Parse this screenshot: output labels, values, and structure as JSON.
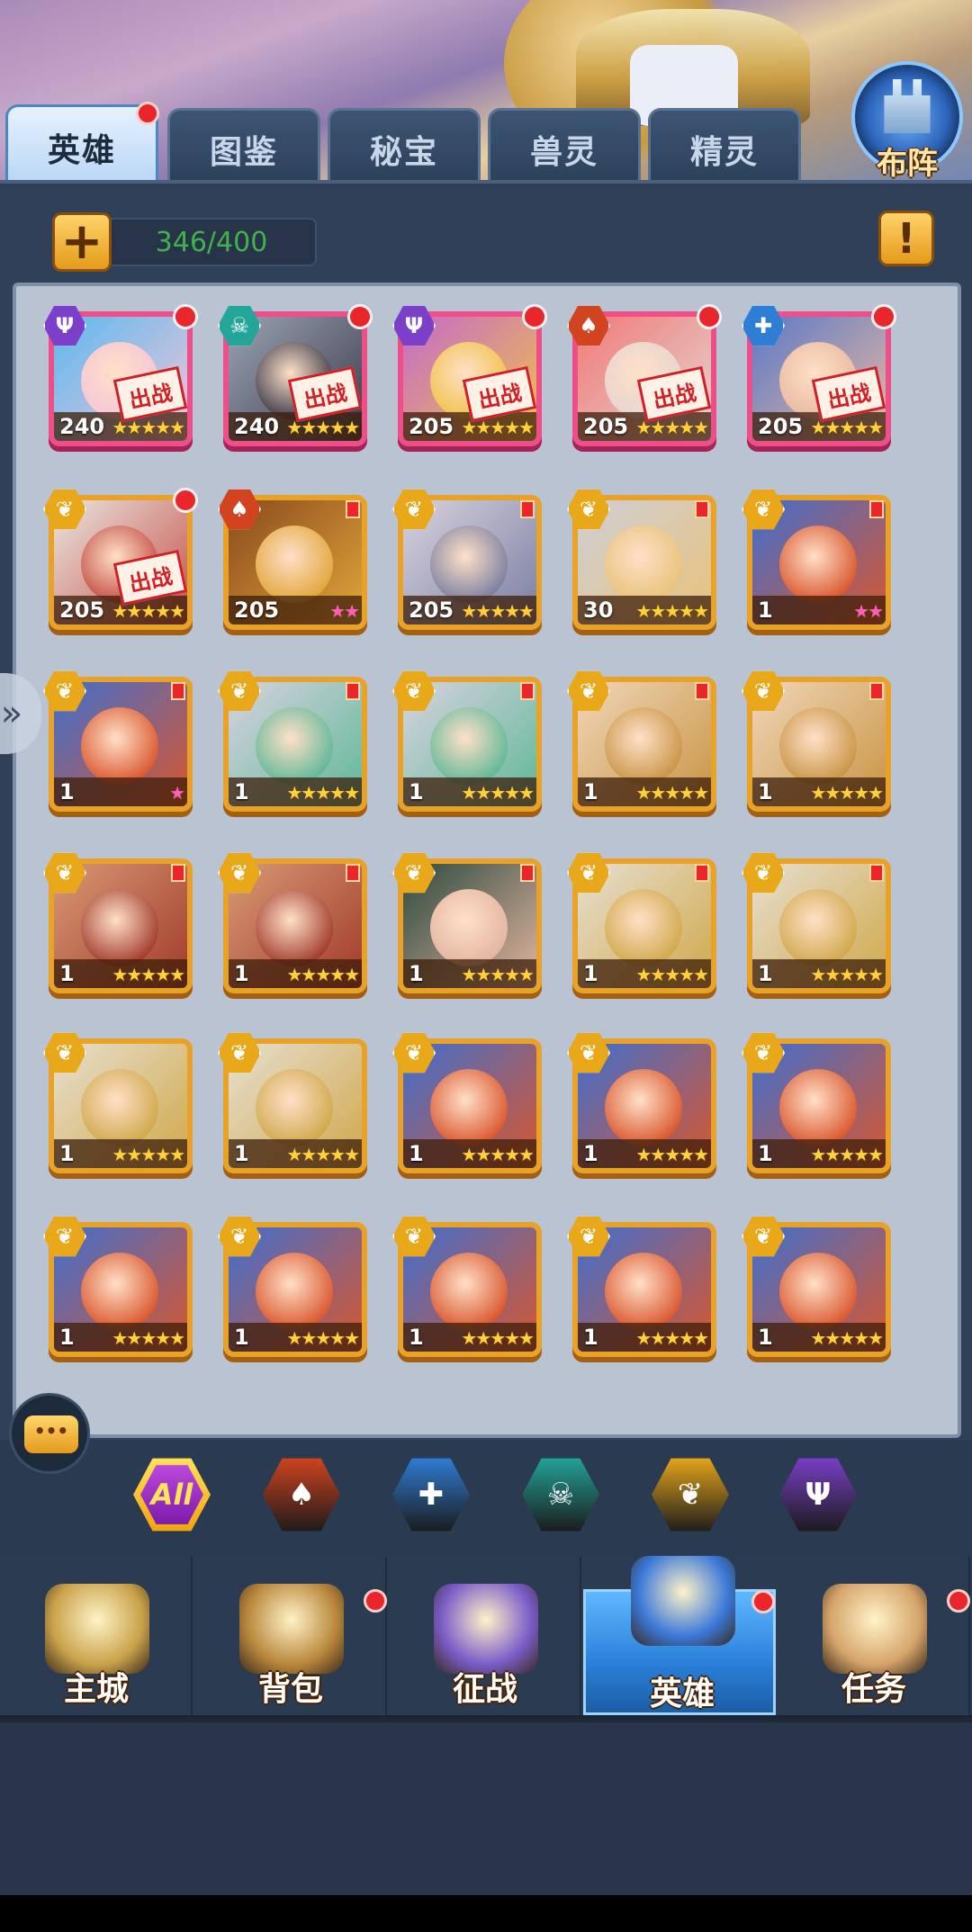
{
  "tabs": [
    {
      "label": "英雄",
      "active": true,
      "dot": true
    },
    {
      "label": "图鉴",
      "active": false,
      "dot": false
    },
    {
      "label": "秘宝",
      "active": false,
      "dot": false
    },
    {
      "label": "兽灵",
      "active": false,
      "dot": false
    },
    {
      "label": "精灵",
      "active": false,
      "dot": false
    }
  ],
  "formation_label": "布阵",
  "capacity": "346/400",
  "add_icon": "plus-icon",
  "info_icon": "exclamation-icon",
  "badge_text": "出战",
  "colors": {
    "gold_frame": "#e8a227",
    "pink_frame": "#ef4f88",
    "level_green": "#3fb34a",
    "red_dot": "#e8262b"
  },
  "factions": {
    "trident": {
      "icon": "trident-icon",
      "color": "#7b3fc9",
      "glyph": "Ψ"
    },
    "skull": {
      "icon": "skull-icon",
      "color": "#23a59a",
      "glyph": "☠"
    },
    "flame": {
      "icon": "flame-icon",
      "color": "#d2441f",
      "glyph": "♠"
    },
    "cross": {
      "icon": "cross-icon",
      "color": "#2f7ed6",
      "glyph": "✚"
    },
    "wing": {
      "icon": "wing-icon",
      "color": "#e8a81a",
      "glyph": "❦"
    }
  },
  "heroes": [
    {
      "level": "240",
      "faction": "trident",
      "stars": 5,
      "deployed": true,
      "dot": true,
      "frame": "pink",
      "palette": [
        "#5ab8f0",
        "#f4c6d8"
      ]
    },
    {
      "level": "240",
      "faction": "skull",
      "stars": 5,
      "deployed": true,
      "dot": true,
      "frame": "pink",
      "palette": [
        "#9aa3b4",
        "#3b3a48"
      ]
    },
    {
      "level": "205",
      "faction": "trident",
      "stars": 5,
      "deployed": true,
      "dot": true,
      "frame": "pink",
      "palette": [
        "#c56ac9",
        "#f0c24a"
      ]
    },
    {
      "level": "205",
      "faction": "flame",
      "stars": 5,
      "deployed": true,
      "dot": true,
      "frame": "pink",
      "palette": [
        "#f07a78",
        "#e5d5d0"
      ]
    },
    {
      "level": "205",
      "faction": "cross",
      "stars": 5,
      "deployed": true,
      "dot": true,
      "frame": "pink",
      "palette": [
        "#5c79c8",
        "#e8b9a0"
      ]
    },
    {
      "level": "205",
      "faction": "wing",
      "stars": 5,
      "deployed": true,
      "dot": true,
      "frame": "gold",
      "palette": [
        "#e9e6e0",
        "#c44f45"
      ]
    },
    {
      "level": "205",
      "faction": "flame",
      "stars": 2,
      "deployed": false,
      "dot": false,
      "flag": true,
      "frame": "gold",
      "pinkstars": true,
      "palette": [
        "#8a4a1d",
        "#e2a63a"
      ]
    },
    {
      "level": "205",
      "faction": "wing",
      "stars": 5,
      "deployed": false,
      "dot": false,
      "flag": true,
      "frame": "gold",
      "palette": [
        "#d8d2df",
        "#7a7fa0"
      ]
    },
    {
      "level": "30",
      "faction": "wing",
      "stars": 5,
      "deployed": false,
      "dot": false,
      "flag": true,
      "frame": "gold",
      "palette": [
        "#cfcfd6",
        "#e8c27a"
      ]
    },
    {
      "level": "1",
      "faction": "wing",
      "stars": 2,
      "deployed": false,
      "dot": false,
      "flag": true,
      "frame": "gold",
      "pinkstars": true,
      "palette": [
        "#3f6fd0",
        "#d9562d"
      ]
    },
    {
      "level": "1",
      "faction": "wing",
      "stars": 1,
      "deployed": false,
      "dot": false,
      "flag": true,
      "frame": "gold",
      "pinkstars": true,
      "palette": [
        "#3f6fd0",
        "#d9562d"
      ]
    },
    {
      "level": "1",
      "faction": "wing",
      "stars": 5,
      "deployed": false,
      "dot": false,
      "flag": true,
      "frame": "gold",
      "palette": [
        "#d8d2df",
        "#5fb898"
      ]
    },
    {
      "level": "1",
      "faction": "wing",
      "stars": 5,
      "deployed": false,
      "dot": false,
      "flag": true,
      "frame": "gold",
      "palette": [
        "#d8d2df",
        "#5fb898"
      ]
    },
    {
      "level": "1",
      "faction": "wing",
      "stars": 5,
      "deployed": false,
      "dot": false,
      "flag": true,
      "frame": "gold",
      "palette": [
        "#f0d6b8",
        "#c99444"
      ]
    },
    {
      "level": "1",
      "faction": "wing",
      "stars": 5,
      "deployed": false,
      "dot": false,
      "flag": true,
      "frame": "gold",
      "palette": [
        "#f0d6b8",
        "#c99444"
      ]
    },
    {
      "level": "1",
      "faction": "wing",
      "stars": 5,
      "deployed": false,
      "dot": false,
      "flag": true,
      "frame": "gold",
      "palette": [
        "#d79a74",
        "#a13a2a"
      ]
    },
    {
      "level": "1",
      "faction": "wing",
      "stars": 5,
      "deployed": false,
      "dot": false,
      "flag": true,
      "frame": "gold",
      "palette": [
        "#d79a74",
        "#a13a2a"
      ]
    },
    {
      "level": "1",
      "faction": "wing",
      "stars": 5,
      "deployed": false,
      "dot": false,
      "flag": true,
      "frame": "gold",
      "palette": [
        "#2b4a3f",
        "#e3b5a0"
      ]
    },
    {
      "level": "1",
      "faction": "wing",
      "stars": 5,
      "deployed": false,
      "dot": false,
      "flag": true,
      "frame": "gold",
      "palette": [
        "#e6dfd0",
        "#d0a84a"
      ]
    },
    {
      "level": "1",
      "faction": "wing",
      "stars": 5,
      "deployed": false,
      "dot": false,
      "flag": true,
      "frame": "gold",
      "palette": [
        "#e6dfd0",
        "#d0a84a"
      ]
    },
    {
      "level": "1",
      "faction": "wing",
      "stars": 5,
      "deployed": false,
      "dot": false,
      "flag": false,
      "frame": "gold",
      "palette": [
        "#e6dfd0",
        "#d0a84a"
      ]
    },
    {
      "level": "1",
      "faction": "wing",
      "stars": 5,
      "deployed": false,
      "dot": false,
      "flag": false,
      "frame": "gold",
      "palette": [
        "#e6dfd0",
        "#d0a84a"
      ]
    },
    {
      "level": "1",
      "faction": "wing",
      "stars": 5,
      "deployed": false,
      "dot": false,
      "flag": false,
      "frame": "gold",
      "palette": [
        "#3f6fd0",
        "#d9562d"
      ]
    },
    {
      "level": "1",
      "faction": "wing",
      "stars": 5,
      "deployed": false,
      "dot": false,
      "flag": false,
      "frame": "gold",
      "palette": [
        "#3f6fd0",
        "#d9562d"
      ]
    },
    {
      "level": "1",
      "faction": "wing",
      "stars": 5,
      "deployed": false,
      "dot": false,
      "flag": false,
      "frame": "gold",
      "palette": [
        "#3f6fd0",
        "#d9562d"
      ]
    },
    {
      "level": "1",
      "faction": "wing",
      "stars": 5,
      "deployed": false,
      "dot": false,
      "flag": false,
      "frame": "gold",
      "palette": [
        "#3f6fd0",
        "#d9562d"
      ]
    },
    {
      "level": "1",
      "faction": "wing",
      "stars": 5,
      "deployed": false,
      "dot": false,
      "flag": false,
      "frame": "gold",
      "palette": [
        "#3f6fd0",
        "#d9562d"
      ]
    },
    {
      "level": "1",
      "faction": "wing",
      "stars": 5,
      "deployed": false,
      "dot": false,
      "flag": false,
      "frame": "gold",
      "palette": [
        "#3f6fd0",
        "#d9562d"
      ]
    },
    {
      "level": "1",
      "faction": "wing",
      "stars": 5,
      "deployed": false,
      "dot": false,
      "flag": false,
      "frame": "gold",
      "palette": [
        "#3f6fd0",
        "#d9562d"
      ]
    },
    {
      "level": "1",
      "faction": "wing",
      "stars": 5,
      "deployed": false,
      "dot": false,
      "flag": false,
      "frame": "gold",
      "palette": [
        "#3f6fd0",
        "#d9562d"
      ]
    }
  ],
  "filters": [
    {
      "label": "All",
      "icon": "all-filter",
      "color": "#f1a10f"
    },
    {
      "label": "",
      "icon": "flame-icon",
      "color": "#d2441f"
    },
    {
      "label": "",
      "icon": "cross-icon",
      "color": "#2f7ed6"
    },
    {
      "label": "",
      "icon": "skull-icon",
      "color": "#23a59a"
    },
    {
      "label": "",
      "icon": "wing-icon",
      "color": "#e8a81a"
    },
    {
      "label": "",
      "icon": "trident-icon",
      "color": "#7b3fc9"
    }
  ],
  "nav": [
    {
      "label": "主城",
      "icon": "castle-icon",
      "active": false,
      "dot": false,
      "color": "#c9a24a"
    },
    {
      "label": "背包",
      "icon": "chest-icon",
      "active": false,
      "dot": true,
      "color": "#b9873c"
    },
    {
      "label": "征战",
      "icon": "dragon-orb-icon",
      "active": false,
      "dot": false,
      "color": "#7a5cc8"
    },
    {
      "label": "英雄",
      "icon": "helmet-icon",
      "active": true,
      "dot": true,
      "color": "#3a78d8"
    },
    {
      "label": "任务",
      "icon": "scroll-icon",
      "active": false,
      "dot": true,
      "color": "#d6a46a"
    }
  ]
}
